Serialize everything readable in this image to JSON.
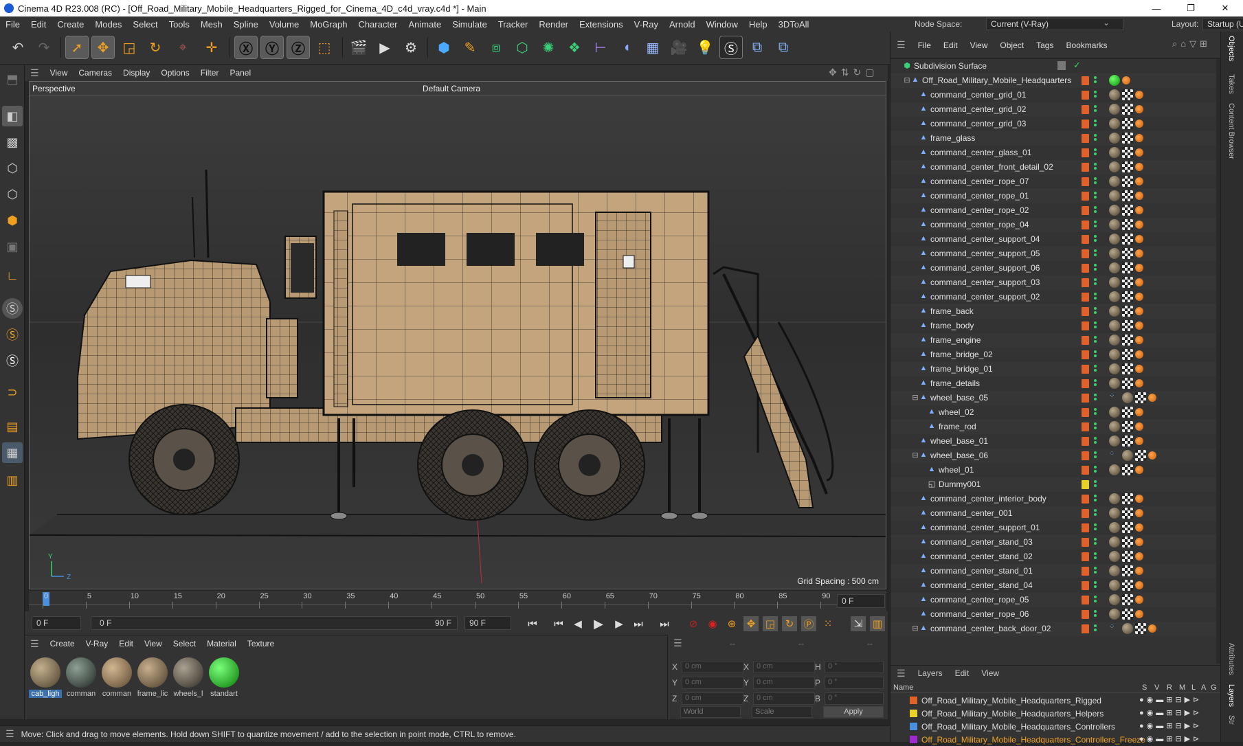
{
  "window": {
    "title": "Cinema 4D R23.008 (RC) - [Off_Road_Military_Mobile_Headquarters_Rigged_for_Cinema_4D_c4d_vray.c4d *] - Main",
    "controls": [
      "—",
      "❐",
      "✕"
    ]
  },
  "menu": [
    "File",
    "Edit",
    "Create",
    "Modes",
    "Select",
    "Tools",
    "Mesh",
    "Spline",
    "Volume",
    "MoGraph",
    "Character",
    "Animate",
    "Simulate",
    "Tracker",
    "Render",
    "Extensions",
    "V-Ray",
    "Arnold",
    "Window",
    "Help",
    "3DToAll"
  ],
  "node_space": {
    "label": "Node Space:",
    "value": "Current (V-Ray)"
  },
  "layout": {
    "label": "Layout:",
    "value": "Startup (User)"
  },
  "viewport": {
    "menu": [
      "View",
      "Cameras",
      "Display",
      "Options",
      "Filter",
      "Panel"
    ],
    "name": "Perspective",
    "camera": "Default Camera",
    "grid_spacing": "Grid Spacing : 500 cm",
    "axis": {
      "y": "Y",
      "z": "Z"
    }
  },
  "timeline": {
    "ticks": [
      "0",
      "5",
      "10",
      "15",
      "20",
      "25",
      "30",
      "35",
      "40",
      "45",
      "50",
      "55",
      "60",
      "65",
      "70",
      "75",
      "80",
      "85",
      "90"
    ],
    "current_frame": "0 F"
  },
  "playback": {
    "start": "0 F",
    "range_start": "0 F",
    "range_end": "90 F",
    "end": "90 F"
  },
  "materials": {
    "menu": [
      "Create",
      "V-Ray",
      "Edit",
      "View",
      "Select",
      "Material",
      "Texture"
    ],
    "items": [
      {
        "label": "cab_ligh",
        "color": "#8a7a63"
      },
      {
        "label": "comman",
        "color": "#4a5a52"
      },
      {
        "label": "comman",
        "color": "#9b8464"
      },
      {
        "label": "frame_lic",
        "color": "#8d7a62"
      },
      {
        "label": "wheels_l",
        "color": "#6b6456"
      },
      {
        "label": "standart",
        "color": "#14c414"
      }
    ]
  },
  "coords": {
    "rows": [
      {
        "a": "X",
        "av": "0 cm",
        "b": "X",
        "bv": "0 cm",
        "c": "H",
        "cv": "0 °"
      },
      {
        "a": "Y",
        "av": "0 cm",
        "b": "Y",
        "bv": "0 cm",
        "c": "P",
        "cv": "0 °"
      },
      {
        "a": "Z",
        "av": "0 cm",
        "b": "Z",
        "bv": "0 cm",
        "c": "B",
        "cv": "0 °"
      }
    ],
    "header": [
      "--",
      "--",
      "--"
    ],
    "world": "World",
    "scale": "Scale",
    "apply": "Apply"
  },
  "status": "Move: Click and drag to move elements. Hold down SHIFT to quantize movement / add to the selection in point mode, CTRL to remove.",
  "objects_menu": [
    "File",
    "Edit",
    "View",
    "Object",
    "Tags",
    "Bookmarks"
  ],
  "objects": [
    {
      "name": "Subdivision Surface",
      "indent": 0,
      "kind": "subdiv"
    },
    {
      "name": "Off_Road_Military_Mobile_Headquarters",
      "indent": 1,
      "kind": "root"
    },
    {
      "name": "command_center_grid_01",
      "indent": 2
    },
    {
      "name": "command_center_grid_02",
      "indent": 2
    },
    {
      "name": "command_center_grid_03",
      "indent": 2
    },
    {
      "name": "frame_glass",
      "indent": 2
    },
    {
      "name": "command_center_glass_01",
      "indent": 2
    },
    {
      "name": "command_center_front_detail_02",
      "indent": 2
    },
    {
      "name": "command_center_rope_07",
      "indent": 2
    },
    {
      "name": "command_center_rope_01",
      "indent": 2
    },
    {
      "name": "command_center_rope_02",
      "indent": 2
    },
    {
      "name": "command_center_rope_04",
      "indent": 2
    },
    {
      "name": "command_center_support_04",
      "indent": 2
    },
    {
      "name": "command_center_support_05",
      "indent": 2
    },
    {
      "name": "command_center_support_06",
      "indent": 2
    },
    {
      "name": "command_center_support_03",
      "indent": 2
    },
    {
      "name": "command_center_support_02",
      "indent": 2
    },
    {
      "name": "frame_back",
      "indent": 2
    },
    {
      "name": "frame_body",
      "indent": 2
    },
    {
      "name": "frame_engine",
      "indent": 2
    },
    {
      "name": "frame_bridge_02",
      "indent": 2
    },
    {
      "name": "frame_bridge_01",
      "indent": 2
    },
    {
      "name": "frame_details",
      "indent": 2
    },
    {
      "name": "wheel_base_05",
      "indent": 2,
      "kind": "group"
    },
    {
      "name": "wheel_02",
      "indent": 3
    },
    {
      "name": "frame_rod",
      "indent": 3
    },
    {
      "name": "wheel_base_01",
      "indent": 2
    },
    {
      "name": "wheel_base_06",
      "indent": 2,
      "kind": "group"
    },
    {
      "name": "wheel_01",
      "indent": 3
    },
    {
      "name": "Dummy001",
      "indent": 3,
      "kind": "dummy"
    },
    {
      "name": "command_center_interior_body",
      "indent": 2
    },
    {
      "name": "command_center_001",
      "indent": 2
    },
    {
      "name": "command_center_support_01",
      "indent": 2
    },
    {
      "name": "command_center_stand_03",
      "indent": 2
    },
    {
      "name": "command_center_stand_02",
      "indent": 2
    },
    {
      "name": "command_center_stand_01",
      "indent": 2
    },
    {
      "name": "command_center_stand_04",
      "indent": 2
    },
    {
      "name": "command_center_rope_05",
      "indent": 2
    },
    {
      "name": "command_center_rope_06",
      "indent": 2
    },
    {
      "name": "command_center_back_door_02",
      "indent": 2,
      "kind": "group"
    }
  ],
  "layers": {
    "menu": [
      "Layers",
      "Edit",
      "View"
    ],
    "columns": {
      "name": "Name",
      "flags": [
        "S",
        "V",
        "R",
        "M",
        "L",
        "A",
        "G"
      ]
    },
    "items": [
      {
        "name": "Off_Road_Military_Mobile_Headquarters_Rigged",
        "color": "#e0612a"
      },
      {
        "name": "Off_Road_Military_Mobile_Headquarters_Helpers",
        "color": "#e8d22a"
      },
      {
        "name": "Off_Road_Military_Mobile_Headquarters_Controllers",
        "color": "#4a8fe0"
      },
      {
        "name": "Off_Road_Military_Mobile_Headquarters_Controllers_Freeze",
        "color": "#a02ad0"
      }
    ]
  },
  "side_tabs": [
    "Objects",
    "Takes",
    "Content Browser",
    "Attributes",
    "Layers",
    "Str"
  ]
}
